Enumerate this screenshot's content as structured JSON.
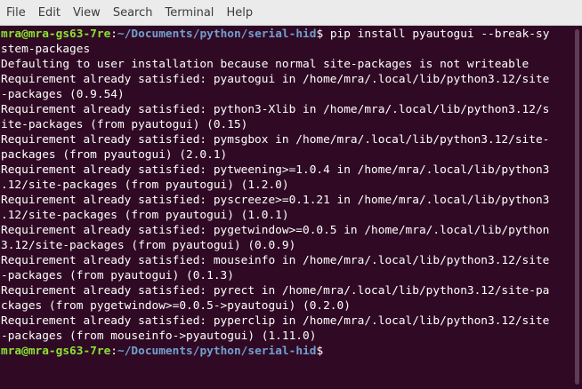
{
  "menu": {
    "file": "File",
    "edit": "Edit",
    "view": "View",
    "search": "Search",
    "terminal": "Terminal",
    "help": "Help"
  },
  "prompt": {
    "user_host": "mra@mra-gs63-7re",
    "colon": ":",
    "path": "~/Documents/python/serial-hid",
    "symbol": "$"
  },
  "command": {
    "part1": " pip install pyautogui --break-sy",
    "part2": "stem-packages"
  },
  "output_lines": [
    "Defaulting to user installation because normal site-packages is not writeable",
    "Requirement already satisfied: pyautogui in /home/mra/.local/lib/python3.12/site",
    "-packages (0.9.54)",
    "Requirement already satisfied: python3-Xlib in /home/mra/.local/lib/python3.12/s",
    "ite-packages (from pyautogui) (0.15)",
    "Requirement already satisfied: pymsgbox in /home/mra/.local/lib/python3.12/site-",
    "packages (from pyautogui) (2.0.1)",
    "Requirement already satisfied: pytweening>=1.0.4 in /home/mra/.local/lib/python3",
    ".12/site-packages (from pyautogui) (1.2.0)",
    "Requirement already satisfied: pyscreeze>=0.1.21 in /home/mra/.local/lib/python3",
    ".12/site-packages (from pyautogui) (1.0.1)",
    "Requirement already satisfied: pygetwindow>=0.0.5 in /home/mra/.local/lib/python",
    "3.12/site-packages (from pyautogui) (0.0.9)",
    "Requirement already satisfied: mouseinfo in /home/mra/.local/lib/python3.12/site",
    "-packages (from pyautogui) (0.1.3)",
    "Requirement already satisfied: pyrect in /home/mra/.local/lib/python3.12/site-pa",
    "ckages (from pygetwindow>=0.0.5->pyautogui) (0.2.0)",
    "Requirement already satisfied: pyperclip in /home/mra/.local/lib/python3.12/site",
    "-packages (from mouseinfo->pyautogui) (1.11.0)"
  ],
  "colors": {
    "background": "#300a24",
    "prompt_user": "#8ae234",
    "prompt_path": "#729fcf",
    "text": "#ffffff"
  }
}
